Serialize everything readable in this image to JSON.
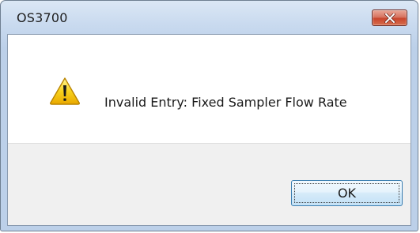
{
  "window": {
    "title": "OS3700"
  },
  "dialog": {
    "message": "Invalid Entry: Fixed Sampler Flow Rate",
    "icon": "warning-icon",
    "ok_label": "OK"
  },
  "colors": {
    "close_button": "#c9452d",
    "warning_yellow": "#f5c400",
    "ok_border": "#3c7fb1"
  }
}
